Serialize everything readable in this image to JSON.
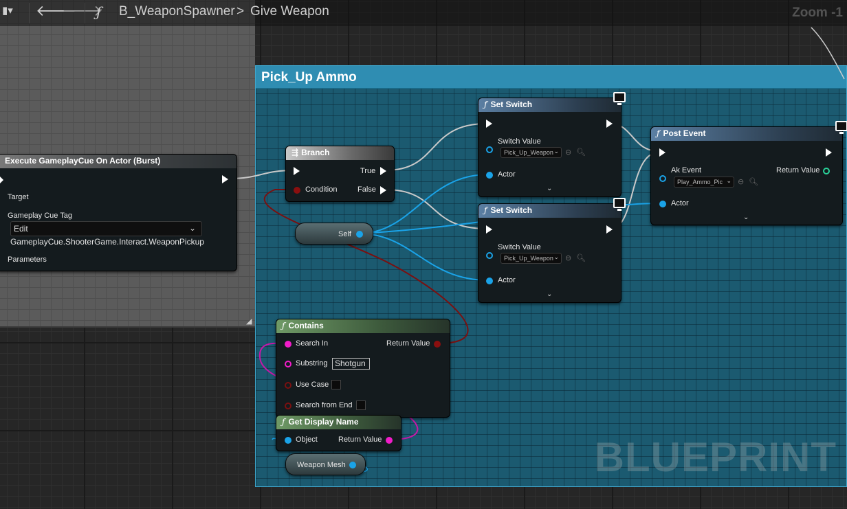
{
  "topbar": {
    "breadcrumb_blueprint": "B_WeaponSpawner",
    "breadcrumb_separator": ">",
    "breadcrumb_function": "Give Weapon",
    "function_symbol": "ƒ",
    "zoom": "Zoom -1"
  },
  "comments": {
    "blue_title": "Pick_Up Ammo",
    "watermark": "BLUEPRINT"
  },
  "nodes": {
    "execute_cue": {
      "title": "Execute GameplayCue On Actor (Burst)",
      "target": "Target",
      "tag_label": "Gameplay Cue Tag",
      "tag_edit": "Edit",
      "tag_value": "GameplayCue.ShooterGame.Interact.WeaponPickup",
      "parameters": "Parameters"
    },
    "branch": {
      "title": "Branch",
      "condition": "Condition",
      "true_label": "True",
      "false_label": "False"
    },
    "self": {
      "label": "Self"
    },
    "set_switch_1": {
      "title": "Set Switch",
      "switch_value": "Switch Value",
      "combo": "Pick_Up_Weapon",
      "actor": "Actor"
    },
    "set_switch_2": {
      "title": "Set Switch",
      "switch_value": "Switch Value",
      "combo": "Pick_Up_Weapon",
      "actor": "Actor"
    },
    "post_event": {
      "title": "Post Event",
      "ak_event": "Ak Event",
      "combo": "Play_Ammo_Pic",
      "return_value": "Return Value",
      "actor": "Actor"
    },
    "contains": {
      "title": "Contains",
      "search_in": "Search In",
      "return_value": "Return Value",
      "substring": "Substring",
      "substring_value": "Shotgun",
      "use_case": "Use Case",
      "search_from_end": "Search from End"
    },
    "get_display_name": {
      "title": "Get Display Name",
      "object": "Object",
      "return_value": "Return Value"
    },
    "weapon_mesh": {
      "label": "Weapon Mesh"
    }
  },
  "colors": {
    "comment_blue": "#1b5a70",
    "comment_title": "#2f8db2",
    "exec_wire": "#d8d8d8",
    "object_pin": "#1aa3e8",
    "bool_pin": "#8a0f0f",
    "string_pin": "#f01cc8"
  }
}
